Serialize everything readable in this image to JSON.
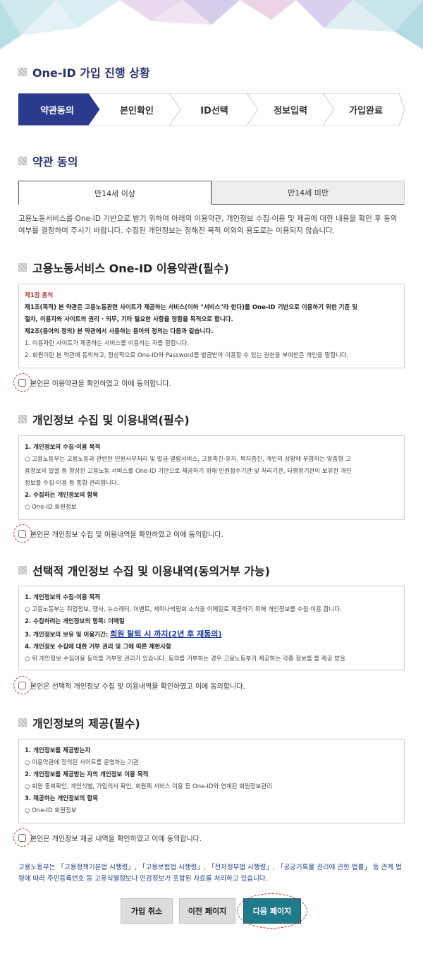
{
  "progress": {
    "title": "One-ID 가입 진행 상황",
    "steps": [
      "약관동의",
      "본인확인",
      "ID선택",
      "정보입력",
      "가입완료"
    ],
    "active_step": "약관동의"
  },
  "terms_title": "약관 동의",
  "age_tabs": {
    "selected": "만14세 이상",
    "other": "만14세 미만"
  },
  "intro": "고용노동서비스를 One-ID 기반으로 받기 위하여 아래의 이용약관, 개인정보 수집·이용 및 제공에 대한 내용을 확인 후 동의 여부를 결정하여 주시기 바랍니다. 수집된 개인정보는 정해진 목적 이외의 용도로는 이용되지 않습니다.",
  "section1": {
    "title": "고용노동서비스 One-ID 이용약관(필수)",
    "chapter": "제1장 총칙",
    "line1": "제1조(목적) 본 약관은 고용노동관련 사이트가 제공하는 서비스(이하 \"서비스\"라 한다)를 One-ID 기반으로 이용하기 위한 기준 및",
    "line2": "절차, 이용자와 사이트의 권리 · 의무, 기타 필요한 사항을 정함을 목적으로 합니다.",
    "line3": "제2조(용어의 정의) 본 약관에서 사용하는 용어의 정의는 다음과 같습니다.",
    "line4": "1. 이용자란 사이트가 제공하는 서비스를 이용하는 자를 말합니다.",
    "line5": "2. 회원이란 본 약관에 동의하고, 정상적으로 One-ID와 Password를 발급받아 이용할 수 있는 권한을 부여받은 개인을 말합니다.",
    "agree": "본인은 이용약관을 확인하였고 이에 동의합니다."
  },
  "section2": {
    "title": "개인정보 수집 및 이용내역(필수)",
    "l1": "1. 개인정보의 수집·이용 목적",
    "l2": "○ 고용노동부는 고용노동과 관련한 민원사무처리 및 발급·열람서비스, 고용촉진·유지, 복지증진, 개인의 상황에 부합하는 맞춤형 고",
    "l3": "용정보의 발굴 등 향상된 고용노동 서비스를 One-ID 기반으로 제공하기 위해 민원접수기관 및 처리기관, 타행정기관이 보유한 개인",
    "l4": "정보를 수집·이용 등 통합 관리합니다.",
    "l5": "2. 수집하는 개인정보의 항목",
    "l6": "○ One-ID 회원정보",
    "agree": "본인은 개인정보 수집 및 이용내역을 확인하였고 이에 동의합니다."
  },
  "section3": {
    "title": "선택적 개인정보 수집 및 이용내역(동의거부 가능)",
    "l1": "1. 개인정보의 수집·이용 목적",
    "l2": "○ 고용노동부는 취업정보, 행사, 뉴스레터, 이벤트, 세미나박람회 소식을 이메일로 제공하기 위해 개인정보를 수집·이용 합니다.",
    "l3": "2. 수집하려는 개인정보의 항목: 이메일",
    "l4_prefix": "3. 개인정보의 보유 및 이용기간: ",
    "l4_link": "회원 탈퇴 시 까지(2년 후 재동의)",
    "l5": "4. 개인정보 수집에 대한 거부 권리 및 그에 따른 제한사항",
    "l6": "○ 위 개인정보 수집이용 동의를 거부할 권리가 있습니다. 동의를 거부하는 경우 고용노동부가 제공하는 각종 정보를 를 제공 받을",
    "agree": "본인은 선택적 개인정보 수집 및 이용내역을 확인하였고 이에 동의합니다."
  },
  "section4": {
    "title": "개인정보의 제공(필수)",
    "l1": "1. 개인정보를 제공받는자",
    "l2": "○ 이용약관에 정의된 사이트를 운영하는 기관",
    "l3": "2. 개인정보를 제공받는 자의 개인정보 이용 목적",
    "l4": "○ 회원 중복확인, 개인식별, 가입의사 확인, 회원제 서비스 이용 등 One-ID와 연계된 회원정보관리",
    "l5": "3. 제공하는 개인정보의 항목",
    "l6": "○ One-ID 회원정보",
    "agree": "본인은 개인정보 제공 내역을 확인하였고 이에 동의합니다."
  },
  "notice": "고용노동부는 「고용정책기본법 시행령」, 「고용보험법 시행령」, 「전자정부법 시행령」, 「공공기록물 관리에 관한 법률」 등 관계 법령에 따라 주민등록번호 등 고유식별정보나 민감정보가 포함된 자료를 처리하고 있습니다.",
  "buttons": {
    "cancel": "가입 취소",
    "prev": "이전 페이지",
    "next": "다음 페이지"
  },
  "colors": {
    "active_step": "#2a3a8c",
    "primary_button": "#1f7a8c",
    "notice_text": "#1d3f8c"
  }
}
